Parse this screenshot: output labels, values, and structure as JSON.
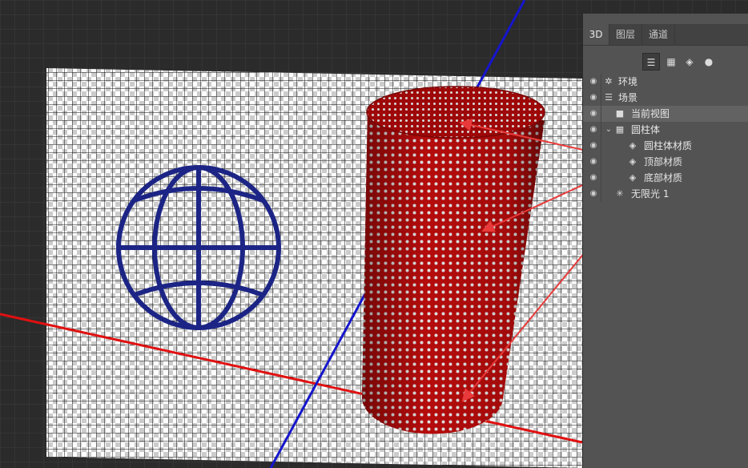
{
  "panel": {
    "tabs": [
      {
        "label": "3D"
      },
      {
        "label": "图层"
      },
      {
        "label": "通道"
      }
    ],
    "toolbar": [
      {
        "icon": "scene-icon"
      },
      {
        "icon": "mesh-icon"
      },
      {
        "icon": "material-icon"
      },
      {
        "icon": "light-icon"
      }
    ],
    "layers": [
      {
        "label": "环境",
        "icon": "environment-icon",
        "visible": true
      },
      {
        "label": "场景",
        "icon": "scene-icon",
        "visible": true
      },
      {
        "label": "当前视图",
        "icon": "camera-icon",
        "visible": true,
        "selected": true
      },
      {
        "label": "圆柱体",
        "icon": "mesh-icon",
        "visible": true,
        "expanded": true
      },
      {
        "label": "圆柱体材质",
        "icon": "material-icon",
        "visible": true
      },
      {
        "label": "顶部材质",
        "icon": "material-icon",
        "visible": true
      },
      {
        "label": "底部材质",
        "icon": "material-icon",
        "visible": true
      },
      {
        "label": "无限光 1",
        "icon": "light-icon",
        "visible": true
      }
    ]
  },
  "colors": {
    "cylinder": "#a80808",
    "globe": "#1c2585",
    "x_axis": "#e01010",
    "y_axis": "#1515cc",
    "annotation_arrows": "#e83a3a",
    "panel_bg": "#535353"
  }
}
